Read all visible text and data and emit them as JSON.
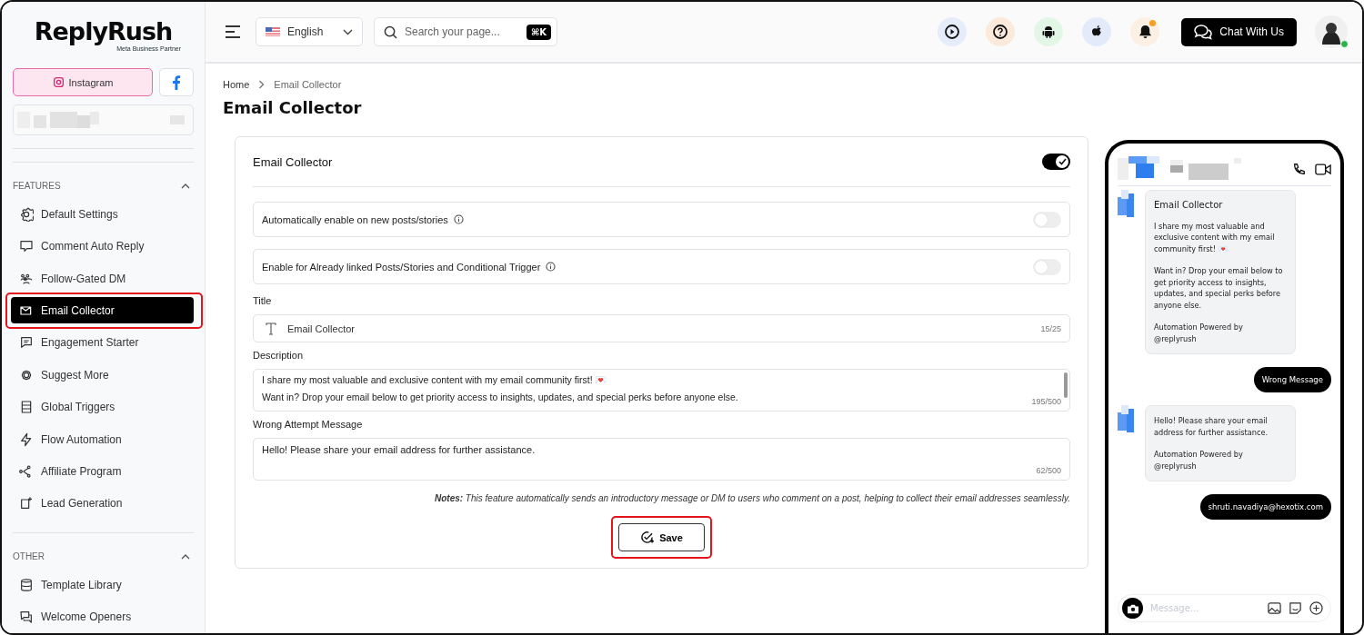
{
  "sidebar": {
    "logo": "ReplyRush",
    "logo_badge": "Meta Business Partner",
    "platforms": [
      {
        "kind": "instagram",
        "label": "Instagram",
        "selected": true
      },
      {
        "kind": "facebook",
        "selected": false
      }
    ],
    "sections": [
      {
        "title": "FEATURES",
        "expanded": true,
        "items": [
          {
            "label": "Default Settings",
            "selected": false,
            "highlighted": false
          },
          {
            "label": "Comment Auto Reply",
            "selected": false,
            "highlighted": false
          },
          {
            "label": "Follow-Gated DM",
            "selected": false,
            "highlighted": false
          },
          {
            "label": "Email Collector",
            "selected": true,
            "highlighted": true
          },
          {
            "label": "Engagement Starter",
            "selected": false,
            "highlighted": false
          },
          {
            "label": "Suggest More",
            "selected": false,
            "highlighted": false
          },
          {
            "label": "Global Triggers",
            "selected": false,
            "highlighted": false
          },
          {
            "label": "Flow Automation",
            "selected": false,
            "highlighted": false
          },
          {
            "label": "Affiliate Program",
            "selected": false,
            "highlighted": false
          },
          {
            "label": "Lead Generation",
            "selected": false,
            "highlighted": false
          }
        ]
      },
      {
        "title": "OTHER",
        "expanded": true,
        "items": [
          {
            "label": "Template Library",
            "selected": false,
            "highlighted": false
          },
          {
            "label": "Welcome Openers",
            "selected": false,
            "highlighted": false
          }
        ]
      }
    ]
  },
  "header": {
    "language": "English",
    "search": {
      "placeholder": "Search your page...",
      "shortcut": "⌘K"
    },
    "notification_dot": true,
    "chat_button": "Chat With Us",
    "online": true
  },
  "breadcrumb": [
    "Home",
    "Email Collector"
  ],
  "page_title": "Email Collector",
  "card": {
    "title": "Email Collector",
    "enabled": true,
    "options": [
      {
        "label": "Automatically enable on new posts/stories",
        "on": false
      },
      {
        "label": "Enable for Already linked Posts/Stories and Conditional Trigger",
        "on": false
      }
    ],
    "title_field": {
      "label": "Title",
      "value": "Email Collector",
      "count": "15/25"
    },
    "description_field": {
      "label": "Description",
      "lines": [
        "I share my most valuable and exclusive content with my email community first! 💌",
        "Want in? Drop your email below to get priority access to insights, updates, and special perks before anyone else."
      ],
      "count": "195/500"
    },
    "wrong_field": {
      "label": "Wrong Attempt Message",
      "value": "Hello! Please share your email address for further assistance.",
      "count": "62/500"
    },
    "notes_label": "Notes:",
    "notes": "This feature automatically sends an introductory message or DM to users who comment on a post, helping to collect their email addresses seamlessly.",
    "save": {
      "label": "Save",
      "highlighted": true
    }
  },
  "preview": {
    "messages": [
      {
        "kind": "bot",
        "title": "Email Collector",
        "paragraphs": [
          "I share my most valuable and exclusive content with my email community first! 💌",
          "Want in? Drop your email below to get priority access to insights, updates, and special perks before anyone else.",
          "Automation Powered by @replyrush"
        ]
      },
      {
        "kind": "user",
        "text": "Wrong Message"
      },
      {
        "kind": "bot",
        "paragraphs": [
          "Hello! Please share your email address for further assistance.",
          "Automation Powered by @replyrush"
        ]
      },
      {
        "kind": "user",
        "text": "shruti.navadiya@hexotix.com"
      }
    ],
    "composer_placeholder": "Message..."
  }
}
